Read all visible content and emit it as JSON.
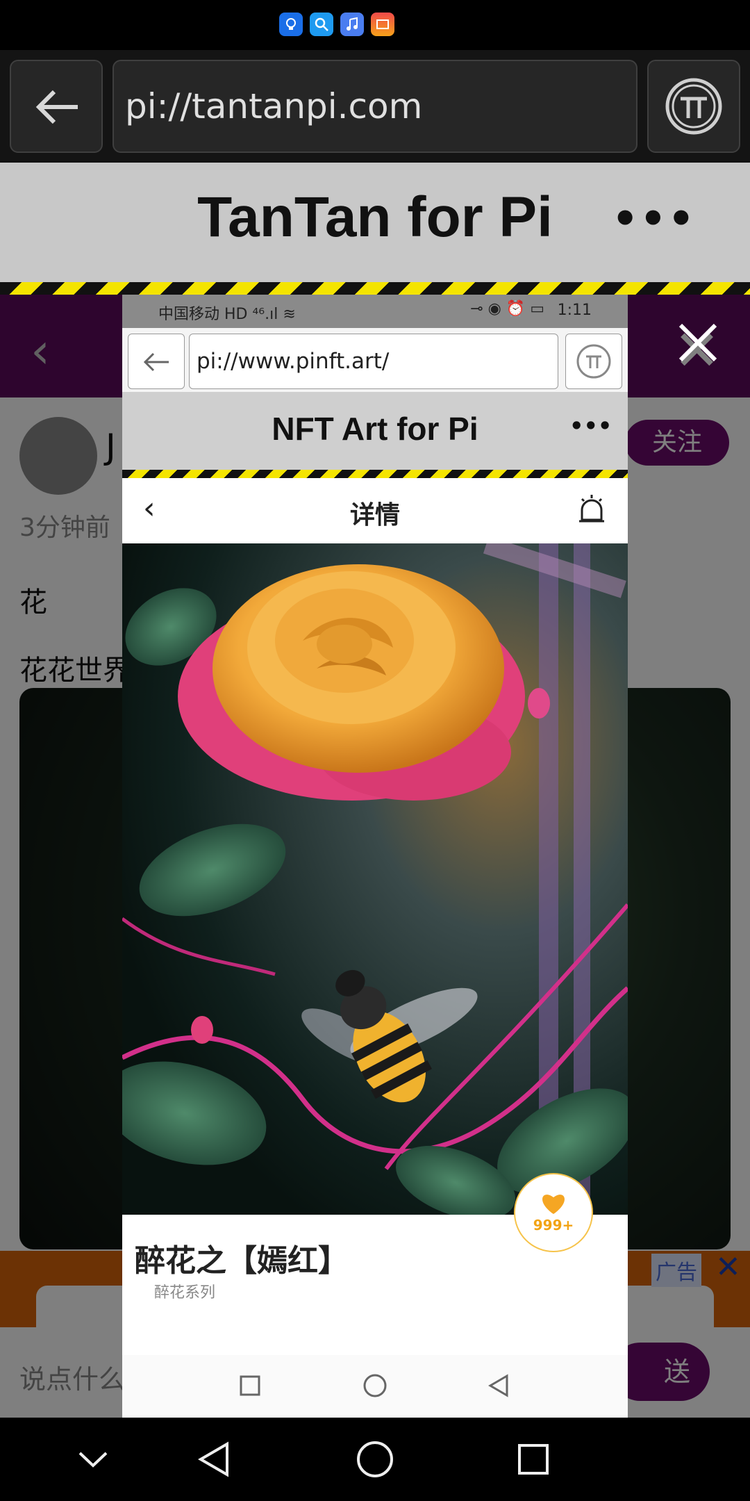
{
  "status_bar": {
    "app_icons": [
      "tips-icon",
      "search-app-icon",
      "music-icon",
      "gallery-icon"
    ]
  },
  "browser": {
    "url": "pi://tantanpi.com"
  },
  "site": {
    "title": "TanTan for Pi",
    "more": "•••"
  },
  "background_page": {
    "author_name": "J",
    "follow_label": "关注",
    "time": "3分钟前",
    "post_text": "花",
    "post_text2": "花花世界",
    "ad_tag": "广告",
    "comment_placeholder": "说点什么",
    "send_label": "送"
  },
  "inner": {
    "status": {
      "carrier": "中国移动 HD ⁴⁶.ıl ≋",
      "icons": "⊸ ◉ ⏰ ▭",
      "time": "1:11"
    },
    "browser": {
      "url": "pi://www.pinft.art/"
    },
    "site": {
      "title": "NFT Art for Pi",
      "more": "•••"
    },
    "nav": {
      "back": "‹",
      "title": "详情"
    },
    "artwork": {
      "title": "醉花之【嫣红】",
      "series": "醉花系列",
      "likes": "999+"
    }
  },
  "colors": {
    "accent_purple": "#6a0b6a",
    "warning_yellow": "#f4e400",
    "like_orange": "#f2a314"
  }
}
